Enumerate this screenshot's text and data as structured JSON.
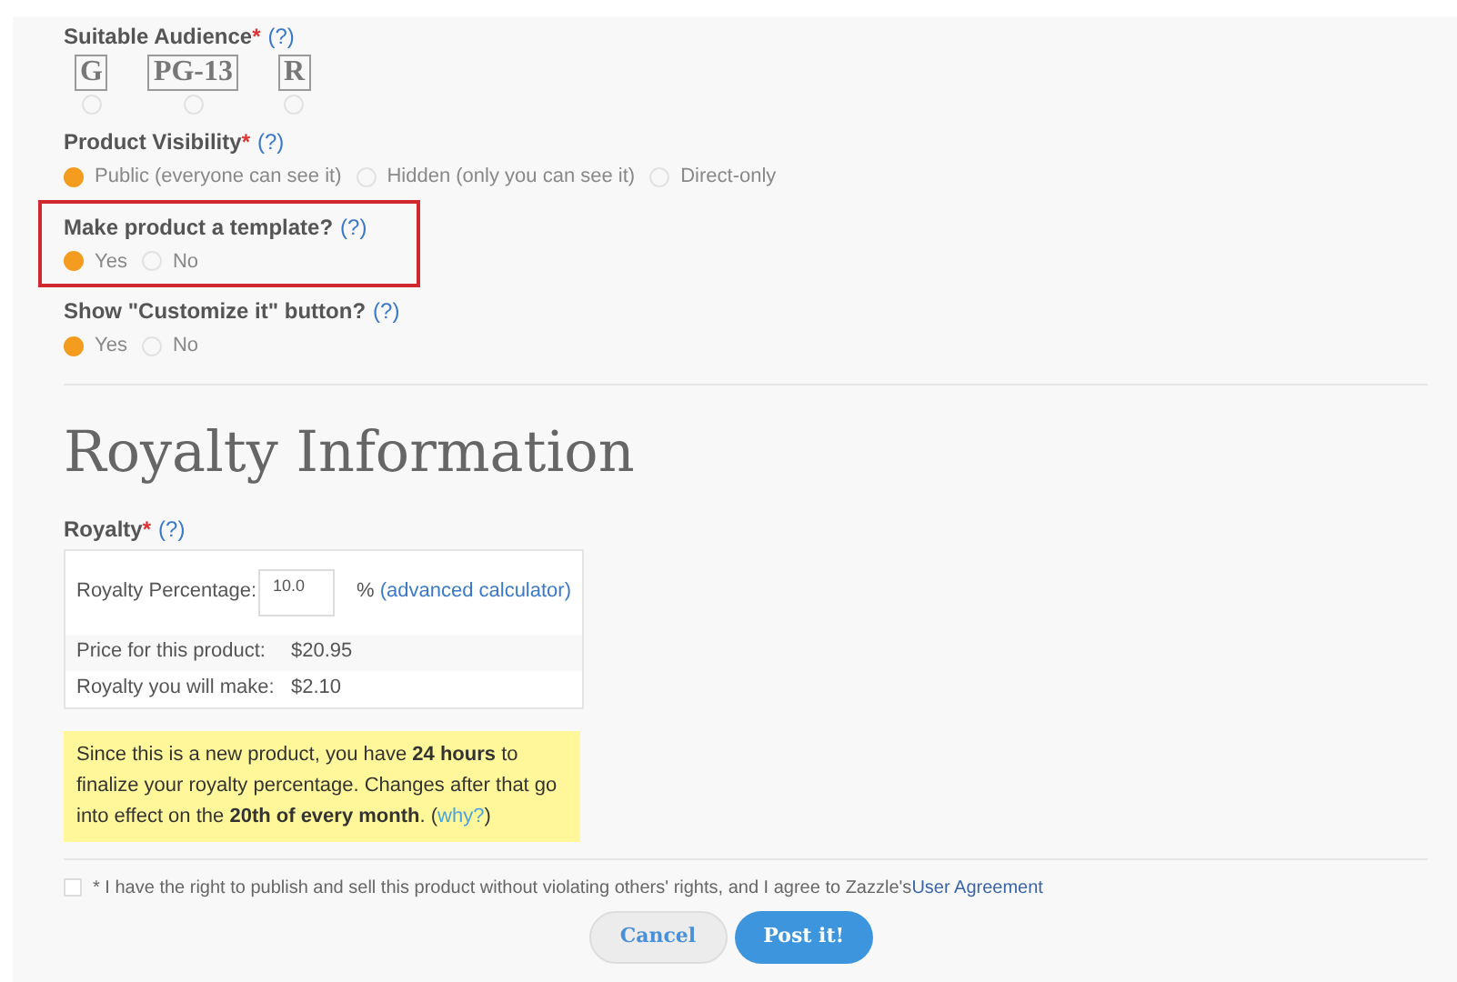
{
  "audience": {
    "label": "Suitable Audience",
    "required": "*",
    "help": "(?)",
    "ratings": [
      {
        "label": "G",
        "selected": false
      },
      {
        "label": "PG-13",
        "selected": false
      },
      {
        "label": "R",
        "selected": false
      }
    ]
  },
  "visibility": {
    "label": "Product Visibility",
    "required": "*",
    "help": "(?)",
    "options": [
      {
        "label": "Public (everyone can see it)",
        "selected": true
      },
      {
        "label": "Hidden (only you can see it)",
        "selected": false
      },
      {
        "label": "Direct-only",
        "selected": false
      }
    ]
  },
  "template": {
    "label": "Make product a template?",
    "help": "(?)",
    "options": [
      {
        "label": "Yes",
        "selected": true
      },
      {
        "label": "No",
        "selected": false
      }
    ]
  },
  "customize": {
    "label": "Show \"Customize it\" button?",
    "help": "(?)",
    "options": [
      {
        "label": "Yes",
        "selected": true
      },
      {
        "label": "No",
        "selected": false
      }
    ]
  },
  "royalty": {
    "heading": "Royalty Information",
    "label": "Royalty",
    "required": "*",
    "help": "(?)",
    "percentage_label": "Royalty Percentage:",
    "percentage_value": "10.0",
    "percent_sign": "%",
    "calculator_link": "(advanced calculator)",
    "rows": [
      {
        "label": "Price for this product:",
        "value": "$20.95"
      },
      {
        "label": "Royalty you will make:",
        "value": "$2.10"
      }
    ],
    "notice": "Since this is a new product, you have **24 hours** to finalize your royalty percentage. Changes after that go into effect on the **20th of every month**. (",
    "notice_link": "why?",
    "notice_end": ")"
  },
  "agreement": {
    "checked": false,
    "text": "* I have the right to publish and sell this product without violating others' rights, and I agree to Zazzle's",
    "link": "User Agreement"
  },
  "buttons": [
    {
      "kind": "secondary",
      "label": "Cancel"
    },
    {
      "kind": "primary",
      "label": "Post it!"
    }
  ]
}
